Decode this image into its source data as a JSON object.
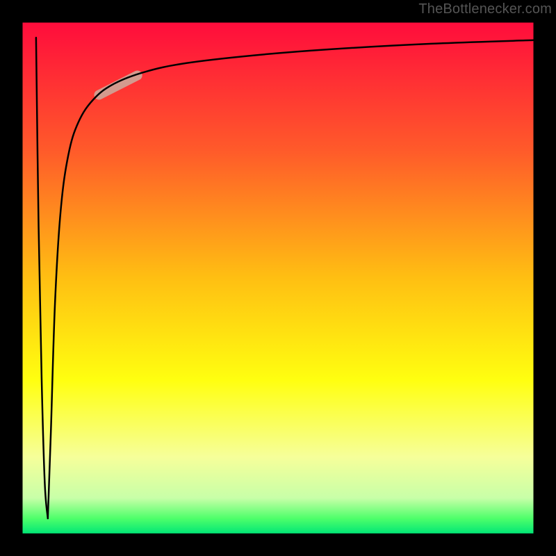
{
  "attribution": "TheBottlenecker.com",
  "chart_data": {
    "type": "line",
    "title": "",
    "xlabel": "",
    "ylabel": "",
    "xlim": [
      0,
      100
    ],
    "ylim": [
      0,
      100
    ],
    "background_gradient": {
      "direction": "vertical",
      "stops": [
        {
          "offset": 0.0,
          "color": "#ff0c3c"
        },
        {
          "offset": 0.25,
          "color": "#ff5a2a"
        },
        {
          "offset": 0.5,
          "color": "#ffbf12"
        },
        {
          "offset": 0.7,
          "color": "#ffff10"
        },
        {
          "offset": 0.85,
          "color": "#f6ff9a"
        },
        {
          "offset": 0.93,
          "color": "#c8ffa8"
        },
        {
          "offset": 0.97,
          "color": "#4eff6a"
        },
        {
          "offset": 1.0,
          "color": "#00e676"
        }
      ]
    },
    "frame_color": "#000000",
    "series": [
      {
        "name": "curve-down",
        "type": "line",
        "color": "#000000",
        "width": 2.5,
        "points": [
          {
            "x": 2.7,
            "y": 97.0
          },
          {
            "x": 3.2,
            "y": 60.0
          },
          {
            "x": 3.8,
            "y": 30.0
          },
          {
            "x": 4.4,
            "y": 10.0
          },
          {
            "x": 5.0,
            "y": 3.0
          }
        ]
      },
      {
        "name": "curve-up",
        "type": "line",
        "color": "#000000",
        "width": 2.5,
        "points": [
          {
            "x": 5.0,
            "y": 3.0
          },
          {
            "x": 5.6,
            "y": 20.0
          },
          {
            "x": 6.4,
            "y": 45.0
          },
          {
            "x": 7.5,
            "y": 63.0
          },
          {
            "x": 9.0,
            "y": 74.0
          },
          {
            "x": 11.0,
            "y": 80.5
          },
          {
            "x": 14.0,
            "y": 85.0
          },
          {
            "x": 18.0,
            "y": 88.0
          },
          {
            "x": 24.0,
            "y": 90.3
          },
          {
            "x": 32.0,
            "y": 92.0
          },
          {
            "x": 45.0,
            "y": 93.5
          },
          {
            "x": 60.0,
            "y": 94.7
          },
          {
            "x": 80.0,
            "y": 95.8
          },
          {
            "x": 100.0,
            "y": 96.5
          }
        ]
      },
      {
        "name": "highlight-segment",
        "type": "line",
        "color": "#d39a8e",
        "width": 14,
        "cap": "round",
        "points": [
          {
            "x": 15.0,
            "y": 85.8
          },
          {
            "x": 22.5,
            "y": 89.6
          }
        ]
      }
    ]
  }
}
